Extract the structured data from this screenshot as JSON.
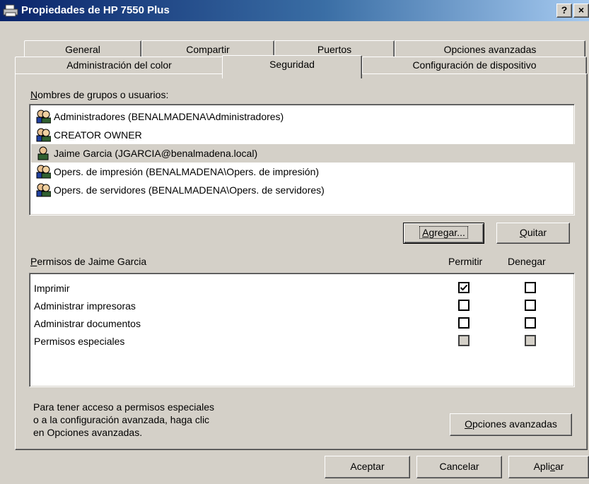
{
  "window": {
    "title": "Propiedades de HP 7550 Plus",
    "help_button": "?",
    "close_button": "×"
  },
  "tabs_row1": [
    "General",
    "Compartir",
    "Puertos",
    "Opciones avanzadas"
  ],
  "tabs_row2": [
    "Administración del color",
    "Seguridad",
    "Configuración de dispositivo"
  ],
  "active_tab": "Seguridad",
  "users_section": {
    "label_accel": "N",
    "label_rest": "ombres de grupos o usuarios:",
    "users": [
      {
        "name": "Administradores (BENALMADENA\\Administradores)",
        "type": "group",
        "selected": false
      },
      {
        "name": "CREATOR OWNER",
        "type": "group",
        "selected": false
      },
      {
        "name": "Jaime Garcia (JGARCIA@benalmadena.local)",
        "type": "user",
        "selected": true
      },
      {
        "name": "Opers. de impresión (BENALMADENA\\Opers. de impresión)",
        "type": "group",
        "selected": false
      },
      {
        "name": "Opers. de servidores (BENALMADENA\\Opers. de servidores)",
        "type": "group",
        "selected": false
      }
    ]
  },
  "buttons": {
    "add_accel": "A",
    "add_rest": "gregar...",
    "remove_accel": "Q",
    "remove_rest": "uitar",
    "advanced_accel": "O",
    "advanced_rest": "pciones avanzadas",
    "ok": "Aceptar",
    "cancel": "Cancelar",
    "apply_pre": "Apli",
    "apply_accel": "c",
    "apply_post": "ar"
  },
  "permissions": {
    "label_accel": "P",
    "label_rest": "ermisos de Jaime Garcia",
    "allow_header": "Permitir",
    "deny_header": "Denegar",
    "rows": [
      {
        "name": "Imprimir",
        "allow": "checked",
        "deny": "unchecked"
      },
      {
        "name": "Administrar impresoras",
        "allow": "unchecked",
        "deny": "unchecked"
      },
      {
        "name": "Administrar documentos",
        "allow": "unchecked",
        "deny": "unchecked"
      },
      {
        "name": "Permisos especiales",
        "allow": "disabled",
        "deny": "disabled"
      }
    ]
  },
  "info_text": {
    "line1": "Para tener acceso a permisos especiales",
    "line2": "o a la configuración avanzada, haga clic",
    "line3": "en Opciones avanzadas."
  }
}
